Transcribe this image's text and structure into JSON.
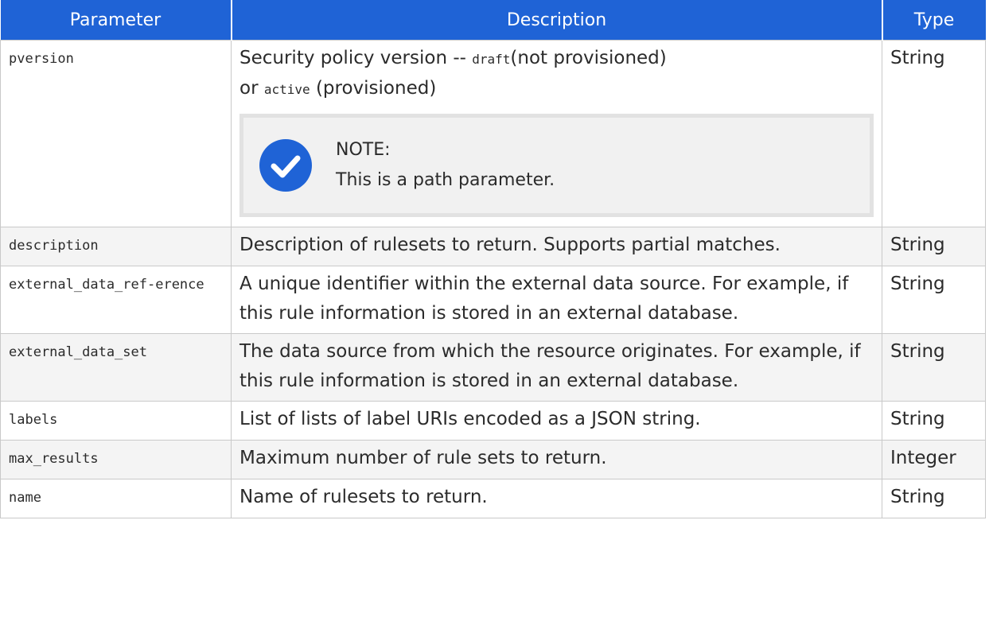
{
  "headers": {
    "parameter": "Parameter",
    "description": "Description",
    "type": "Type"
  },
  "rows": [
    {
      "param": "pversion",
      "desc_parts": {
        "a": "Security policy version -- ",
        "b": "draft",
        "c": "(not provisioned)",
        "d": "or ",
        "e": "active",
        "f": " (provisioned)"
      },
      "note": {
        "title": "NOTE:",
        "text": "This is a path parameter."
      },
      "type": "String"
    },
    {
      "param": "description",
      "desc": "Description of rulesets to return. Supports partial matches.",
      "type": "String"
    },
    {
      "param": "external_data_ref-erence",
      "desc": "A unique identifier within the external data source. For example, if this rule information is stored in an external database.",
      "type": "String"
    },
    {
      "param": "external_data_set",
      "desc": "The data source from which the resource originates. For example, if this rule information is stored in an external database.",
      "type": "String"
    },
    {
      "param": "labels",
      "desc": "List of lists of label URIs encoded as a JSON string.",
      "type": "String"
    },
    {
      "param": "max_results",
      "desc": "Maximum number of rule sets to return.",
      "type": "Integer"
    },
    {
      "param": "name",
      "desc": "Name of rulesets to return.",
      "type": "String"
    }
  ],
  "colors": {
    "header_bg": "#1f63d6",
    "icon": "#1f63d6"
  }
}
